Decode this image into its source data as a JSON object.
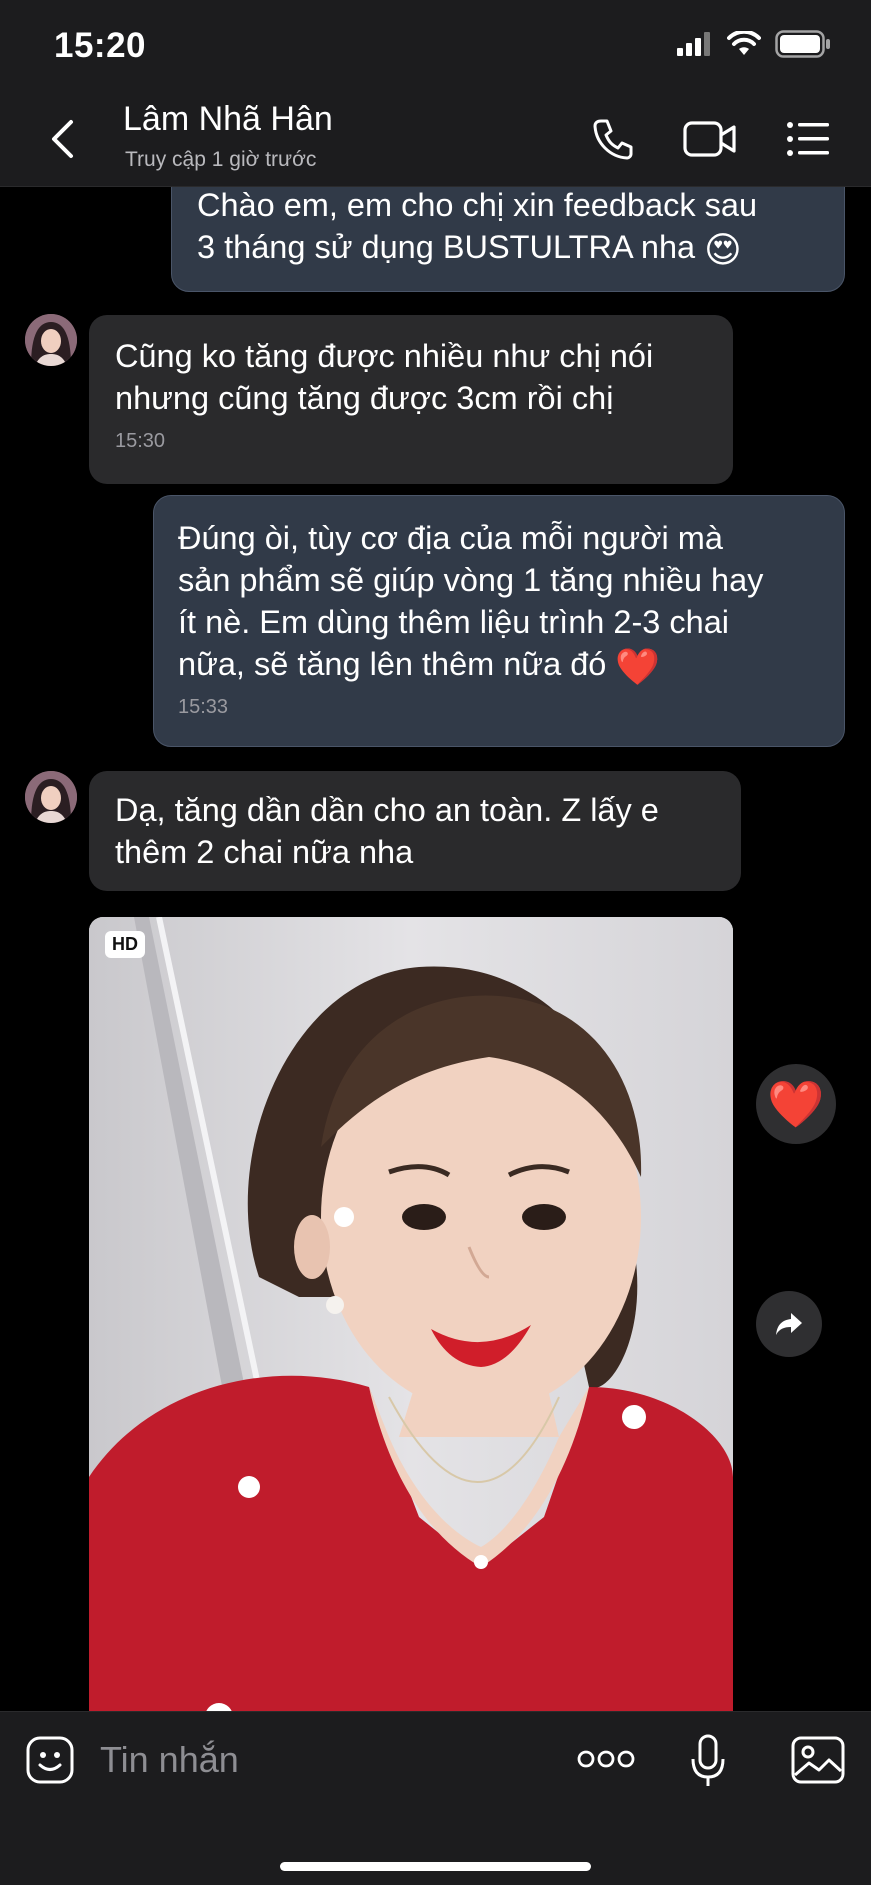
{
  "status": {
    "time": "15:20"
  },
  "header": {
    "name": "Lâm Nhã Hân",
    "status": "Truy cập 1 giờ trước"
  },
  "messages": [
    {
      "direction": "out",
      "text": "Chào em, em cho chị xin feedback sau\n3 tháng sử dụng BUSTULTRA nha",
      "emoji": "😍"
    },
    {
      "direction": "in",
      "text": "Cũng ko tăng được nhiều như chị nói\nnhưng cũng tăng được 3cm rồi chị",
      "time": "15:30"
    },
    {
      "direction": "out",
      "text": "Đúng òi, tùy cơ địa của mỗi người mà\nsản phẩm sẽ giúp vòng 1 tăng nhiều hay\nít nè. Em dùng thêm liệu trình 2-3 chai\nnữa, sẽ tăng lên thêm nữa đó",
      "emoji": "❤️",
      "time": "15:33"
    },
    {
      "direction": "in",
      "text": "Dạ, tăng dần dần cho an toàn. Z lấy e\nthêm 2 chai nữa nha"
    }
  ],
  "photo": {
    "badge": "HD"
  },
  "reaction": {
    "emoji": "❤️"
  },
  "composer": {
    "placeholder": "Tin nhắn"
  },
  "icons": {
    "back": "chevron-left-icon",
    "call": "phone-icon",
    "video": "video-camera-icon",
    "menu": "list-menu-icon",
    "emoji": "emoji-sticker-icon",
    "more": "more-dots-icon",
    "mic": "microphone-icon",
    "gallery": "image-gallery-icon",
    "share": "share-forward-icon"
  },
  "colors": {
    "outgoing_bubble": "#313a48",
    "incoming_bubble": "#2a2a2c",
    "bar_background": "#1c1c1e",
    "timestamp": "#9a9aa0"
  }
}
